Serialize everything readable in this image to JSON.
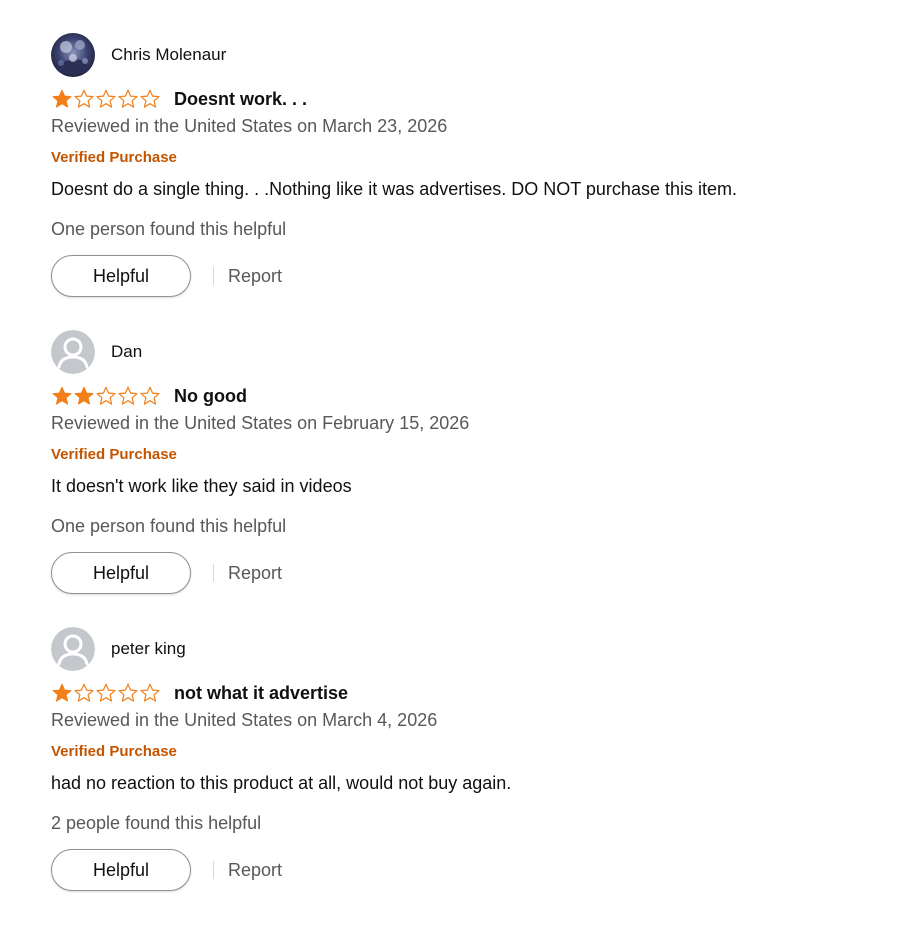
{
  "colors": {
    "star_fill": "#f27f1a",
    "star_outline": "#f27f1a",
    "verified": "#c45500",
    "secondary_text": "#565959",
    "primary_text": "#0f1111"
  },
  "reviews": [
    {
      "profile_name": "Chris Molenaur",
      "avatar": "photo-avatar",
      "rating": 1,
      "rating_max": 5,
      "title": "Doesnt work. . .",
      "date": "Reviewed in the United States on March 23, 2026",
      "verified": "Verified Purchase",
      "body": "Doesnt do a single thing. . .Nothing like it was advertises. DO NOT purchase this item.",
      "helpful_count": "One person found this helpful",
      "helpful_label": "Helpful",
      "report_label": "Report"
    },
    {
      "profile_name": "Dan",
      "avatar": "default-user-avatar",
      "rating": 2,
      "rating_max": 5,
      "title": "No good",
      "date": "Reviewed in the United States on February 15, 2026",
      "verified": "Verified Purchase",
      "body": "It doesn't work like they said in videos",
      "helpful_count": "One person found this helpful",
      "helpful_label": "Helpful",
      "report_label": "Report"
    },
    {
      "profile_name": "peter king",
      "avatar": "default-user-avatar",
      "rating": 1,
      "rating_max": 5,
      "title": "not what it advertise",
      "date": "Reviewed in the United States on March 4, 2026",
      "verified": "Verified Purchase",
      "body": "had no reaction to this product at all, would not buy again.",
      "helpful_count": "2 people found this helpful",
      "helpful_label": "Helpful",
      "report_label": "Report"
    }
  ]
}
